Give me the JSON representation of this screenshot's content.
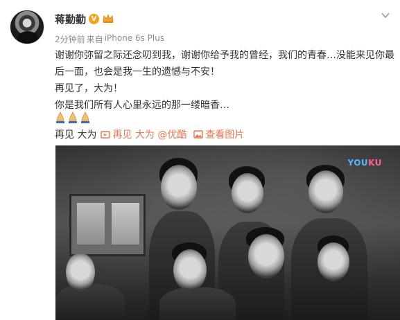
{
  "post": {
    "username": "蒋勤勤",
    "verified_badge": "V",
    "time": "2分钟前",
    "source_prefix": "来自",
    "source": "iPhone 6s Plus",
    "lines": [
      "谢谢你弥留之际还念叨到我，谢谢你给予我的曾经，我们的青春…没能来见你最",
      "后一面，也会是我一生的遗憾与不安！",
      "再见了，大为！",
      "你是我们所有人心里永远的那一缕暗香…"
    ],
    "emojis": [
      "pray-icon",
      "pray-icon",
      "pray-icon"
    ],
    "tag_text": "再见 大为",
    "video_link": "再见 大为 @优酷",
    "image_link": "查看图片"
  },
  "video": {
    "logo_part1": "YOU",
    "logo_part2": "KU"
  },
  "colors": {
    "link": "#eb7350",
    "text": "#333333",
    "meta": "#8c8c8c",
    "badge": "#f7a21b"
  }
}
